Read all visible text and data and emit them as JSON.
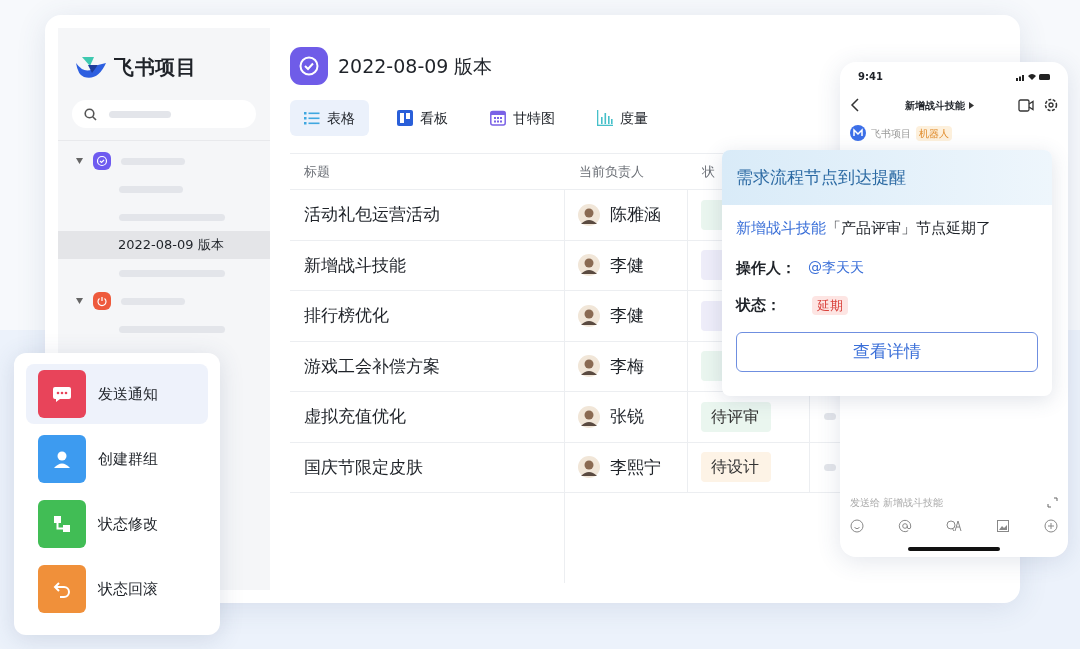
{
  "sidebar": {
    "brand": "飞书项目",
    "items": [
      {
        "label": "2022-08-09 版本",
        "selected": true
      }
    ]
  },
  "header": {
    "title": "2022-08-09 版本"
  },
  "tabs": [
    {
      "label": "表格",
      "selected": true
    },
    {
      "label": "看板",
      "selected": false
    },
    {
      "label": "甘特图",
      "selected": false
    },
    {
      "label": "度量",
      "selected": false
    }
  ],
  "table": {
    "columns": [
      "标题",
      "当前负责人",
      "状"
    ],
    "rows": [
      {
        "title": "活动礼包运营活动",
        "assignee": "陈雅涵",
        "color": "#eaf6ef"
      },
      {
        "title": "新增战斗技能",
        "assignee": "李健",
        "color": "#eeedf9"
      },
      {
        "title": "排行榜优化",
        "assignee": "李健",
        "color": "#eeedf9"
      },
      {
        "title": "游戏工会补偿方案",
        "assignee": "李梅",
        "color": "#eaf6ef"
      },
      {
        "title": "虚拟充值优化",
        "assignee": "张锐",
        "status": "待评审",
        "color": "#eaf6ef"
      },
      {
        "title": "国庆节限定皮肤",
        "assignee": "李熙宁",
        "status": "待设计",
        "color": "#fdf3e6"
      }
    ]
  },
  "actions": [
    {
      "label": "发送通知",
      "color": "#e8445a",
      "selected": true
    },
    {
      "label": "创建群组",
      "color": "#3d9bf0",
      "selected": false
    },
    {
      "label": "状态修改",
      "color": "#41bd55",
      "selected": false
    },
    {
      "label": "状态回滚",
      "color": "#f0903a",
      "selected": false
    }
  ],
  "phone": {
    "time": "9:41",
    "chat_title": "新增战斗技能",
    "bot_name": "飞书项目",
    "bot_badge": "机器人",
    "input_placeholder": "发送给 新增战斗技能"
  },
  "notification": {
    "title": "需求流程节点到达提醒",
    "link": "新增战斗技能",
    "message": "「产品评审」节点延期了",
    "operator_label": "操作人：",
    "operator": "@李天天",
    "status_label": "状态：",
    "status": "延期",
    "button": "查看详情"
  }
}
